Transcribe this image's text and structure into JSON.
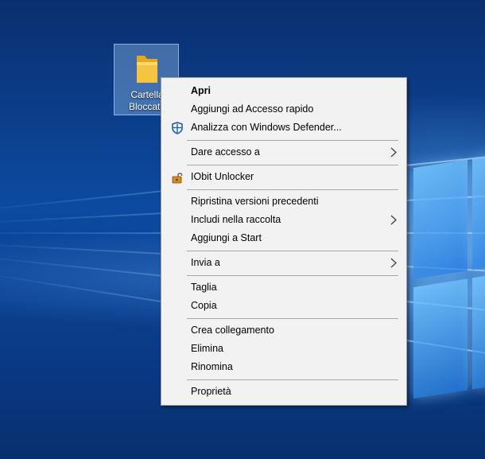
{
  "desktop": {
    "icon": {
      "icon": "folder-icon",
      "label_line1": "Cartella",
      "label_line2": "Bloccata"
    }
  },
  "context_menu": {
    "items": [
      {
        "label": "Apri",
        "bold": true
      },
      {
        "label": "Aggiungi ad Accesso rapido"
      },
      {
        "label": "Analizza con Windows Defender...",
        "icon": "windows-defender-icon"
      },
      {
        "label": "Dare accesso a",
        "submenu": true
      },
      {
        "label": "IObit Unlocker",
        "icon": "iobit-unlocker-icon"
      },
      {
        "label": "Ripristina versioni precedenti"
      },
      {
        "label": "Includi nella raccolta",
        "submenu": true
      },
      {
        "label": "Aggiungi a Start"
      },
      {
        "label": "Invia a",
        "submenu": true
      },
      {
        "label": "Taglia"
      },
      {
        "label": "Copia"
      },
      {
        "label": "Crea collegamento"
      },
      {
        "label": "Elimina"
      },
      {
        "label": "Rinomina"
      },
      {
        "label": "Proprietà"
      }
    ]
  },
  "colors": {
    "menu_background": "#f2f2f2",
    "desktop_blue": "#0c4aa0",
    "folder_yellow": "#f5c542",
    "defender_blue": "#1a5fb4"
  }
}
